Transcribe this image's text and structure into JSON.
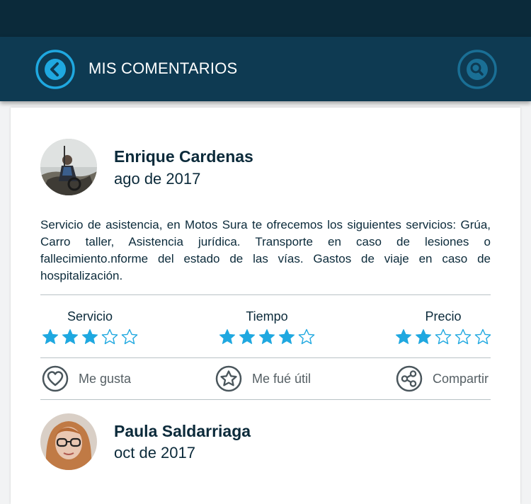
{
  "header": {
    "title": "MIS COMENTARIOS",
    "back_icon": "chevron-left-icon",
    "search_icon": "search-icon"
  },
  "colors": {
    "statusbar": "#0b2a3a",
    "appbar": "#0e3a52",
    "accent": "#1fa8e0",
    "text": "#0b2a3a"
  },
  "reviews": [
    {
      "name": "Enrique Cardenas",
      "date": "ago de 2017",
      "text": "Servicio de asistencia, en Motos Sura te ofrecemos los siguientes servicios: Grúa, Carro taller, Asistencia jurídica. Transporte en caso de lesiones o fallecimiento.nforme del estado de las vías. Gastos de viaje en caso de hospitalización.",
      "ratings": [
        {
          "label": "Servicio",
          "stars": 3,
          "max": 5
        },
        {
          "label": "Tiempo",
          "stars": 4,
          "max": 5
        },
        {
          "label": "Precio",
          "stars": 2,
          "max": 5
        }
      ],
      "actions": [
        {
          "label": "Me gusta",
          "icon": "heart-icon"
        },
        {
          "label": "Me fué útil",
          "icon": "star-icon"
        },
        {
          "label": "Compartir",
          "icon": "share-icon"
        }
      ]
    },
    {
      "name": "Paula Saldarriaga",
      "date": "oct de 2017"
    }
  ]
}
